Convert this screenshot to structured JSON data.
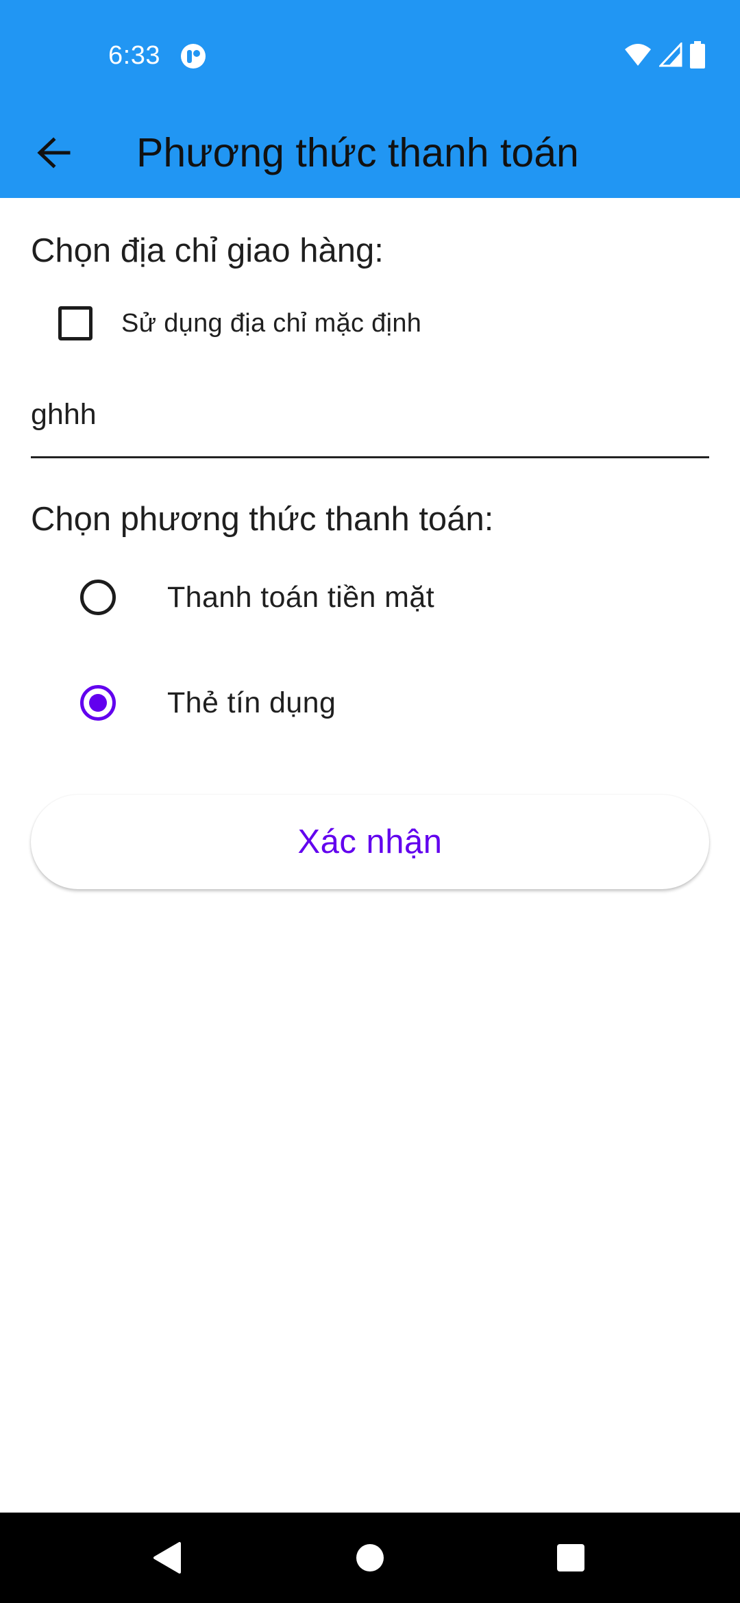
{
  "status_bar": {
    "time": "6:33",
    "app_icon": "notification-app-icon",
    "icons": [
      "wifi-icon",
      "cell-signal-icon",
      "battery-icon"
    ]
  },
  "toolbar": {
    "title": "Phương thức thanh toán",
    "back_icon": "back-arrow-icon",
    "background": "#2196F3"
  },
  "shipping": {
    "heading": "Chọn địa chỉ giao hàng:",
    "use_default_label": "Sử dụng địa chỉ mặc định",
    "use_default_checked": false,
    "address_value": "ghhh"
  },
  "payment": {
    "heading": "Chọn phương thức thanh toán:",
    "options": [
      {
        "label": "Thanh toán tiền mặt",
        "selected": false
      },
      {
        "label": "Thẻ tín dụng",
        "selected": true
      }
    ]
  },
  "confirm_button": {
    "label": "Xác nhận"
  },
  "colors": {
    "accent": "#6200EE",
    "app_bar": "#2196F3"
  },
  "nav_bar": {
    "buttons": [
      "back-triangle-icon",
      "home-circle-icon",
      "recents-square-icon"
    ]
  }
}
